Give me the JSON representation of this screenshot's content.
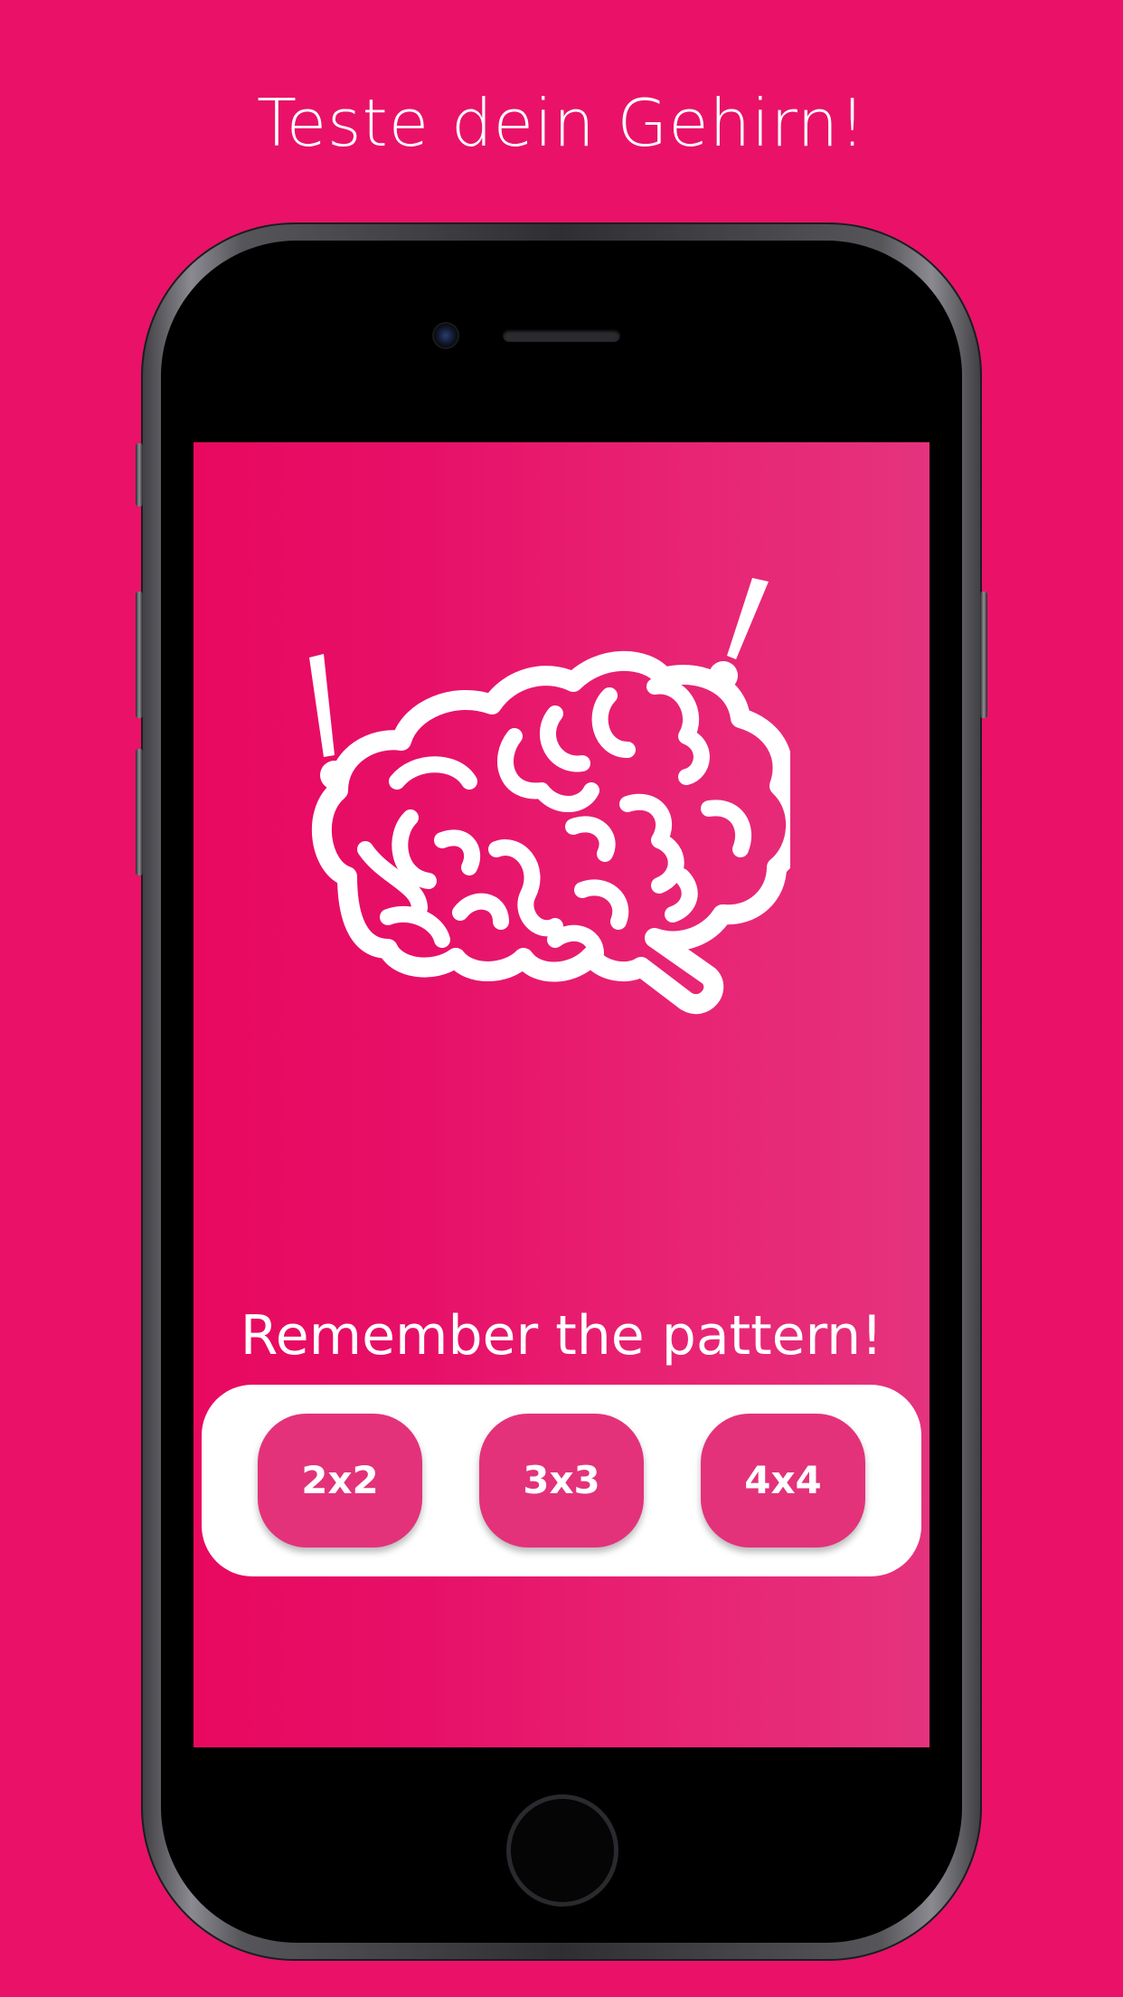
{
  "headline": "Teste dein Gehirn!",
  "screen": {
    "illustration_icon": "brain-icon",
    "tagline": "Remember the pattern!",
    "grid_options": [
      {
        "label": "2x2"
      },
      {
        "label": "3x3"
      },
      {
        "label": "4x4"
      }
    ]
  },
  "colors": {
    "background": "#E91268",
    "screen_gradient_start": "#E8095F",
    "screen_gradient_end": "#E5337E",
    "button": "#E3327A",
    "panel": "#FFFFFF",
    "text": "#FFFFFF"
  }
}
